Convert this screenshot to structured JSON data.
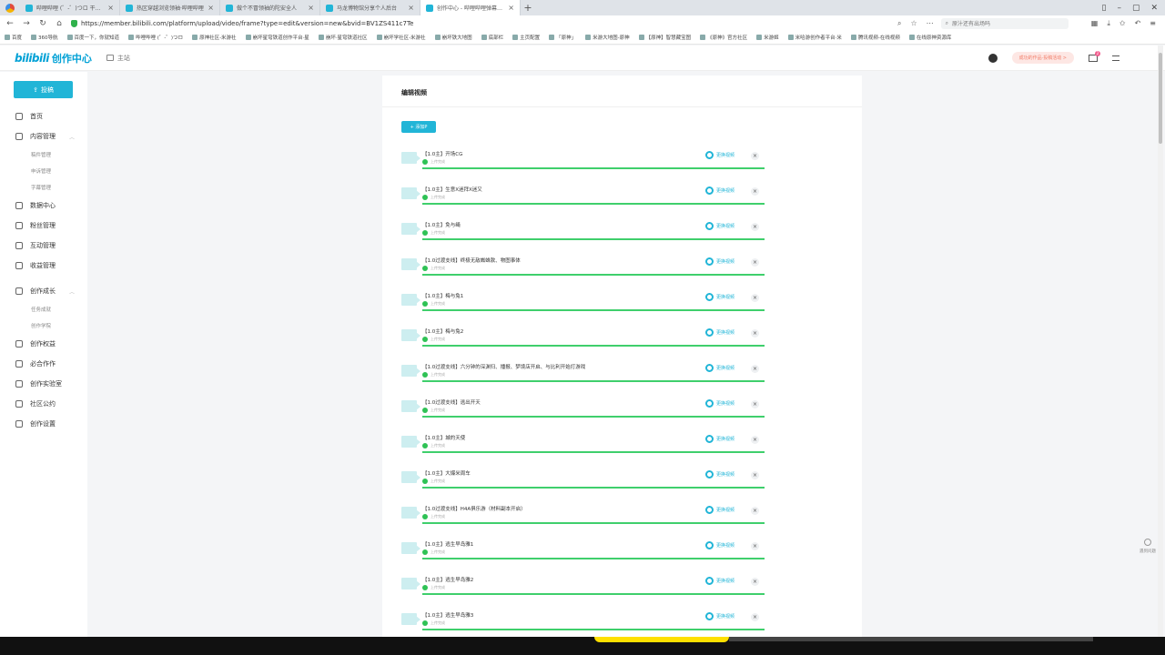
{
  "browser": {
    "tabs": [
      {
        "title": "哔哩哔哩 (゜-゜)つロ 干杯~",
        "active": false
      },
      {
        "title": "热区穿越浏览领袖·哔哩哔哩",
        "active": false
      },
      {
        "title": "做个不冒领袖的陀安全人",
        "active": false
      },
      {
        "title": "马龙博物馆分享个人后台",
        "active": false
      },
      {
        "title": "创作中心 - 哔哩哔哩弹幕视频",
        "active": true
      }
    ],
    "new_tab": "+",
    "url": "https://member.bilibili.com/platform/upload/video/frame?type=edit&version=new&bvid=BV1ZS411c7Te",
    "search_placeholder": "原汁还有出场吗",
    "bookmarks": [
      "百度",
      "360导航",
      "百度一下，你就知道",
      "哔哩哔哩 (゜-゜)つロ",
      "原神社区-米游社",
      "崩坏星穹铁道创作平台·星",
      "崩坏·星穹铁道社区",
      "崩坏学社区-米游社",
      "崩坏铁大地图",
      "底部栏",
      "主页配置",
      "「原神」",
      "米游大地图-原神",
      "【原神】智慧藏宝图",
      "《原神》官方社区",
      "米游姬",
      "米哈游创作者平台·米",
      "腾讯视频-在线视频",
      "在线原神资源库"
    ]
  },
  "header": {
    "brand": "创作中心",
    "brand_logo": "bilibili",
    "home_label": "主站",
    "promo": "成功的作品·投稿活动 >",
    "msg_count": "2"
  },
  "sidebar": {
    "upload_label": "投稿",
    "items": [
      {
        "label": "首页",
        "icon": "home-icon"
      },
      {
        "label": "内容管理",
        "icon": "content-icon",
        "subs": [
          "稿件管理",
          "申诉管理",
          "字幕管理"
        ]
      },
      {
        "label": "数据中心",
        "icon": "data-icon"
      },
      {
        "label": "粉丝管理",
        "icon": "fans-icon"
      },
      {
        "label": "互动管理",
        "icon": "interact-icon"
      },
      {
        "label": "收益管理",
        "icon": "income-icon"
      },
      {
        "label": "创作成长",
        "icon": "growth-icon",
        "subs": [
          "任务成就",
          "创作学院"
        ]
      },
      {
        "label": "创作权益",
        "icon": "rights-icon"
      },
      {
        "label": "必合作作",
        "icon": "cooperate-icon"
      },
      {
        "label": "创作实验室",
        "icon": "lab-icon"
      },
      {
        "label": "社区公约",
        "icon": "rules-icon"
      },
      {
        "label": "创作设置",
        "icon": "settings-icon"
      }
    ]
  },
  "panel": {
    "title": "编辑视频",
    "add_button": "+ 添加P",
    "replace_label": "更换视频",
    "status_text": "上传完成",
    "videos": [
      "【1.0主】开场CG",
      "【1.0主】生意X迷拜X迷又",
      "【1.0主】免与绳",
      "【1.0过渡支线】终极无敌蜘蛛款、物图事体",
      "【1.0主】梅与兔1",
      "【1.0主】梅与兔2",
      "【1.0过渡支线】六分钟的深渊归、播报、梦境店开启、与比利开始打游戏",
      "【1.0过渡支线】逃出开天",
      "【1.0主】城的天使",
      "【1.0主】大爆米周车",
      "【1.0过渡支线】H4A俱乐游（材料副本开启）",
      "【1.0主】逃生早岛雅1",
      "【1.0主】逃生早岛雅2",
      "【1.0主】逃生早岛雅3"
    ]
  },
  "help": {
    "label": "遇到问题"
  }
}
